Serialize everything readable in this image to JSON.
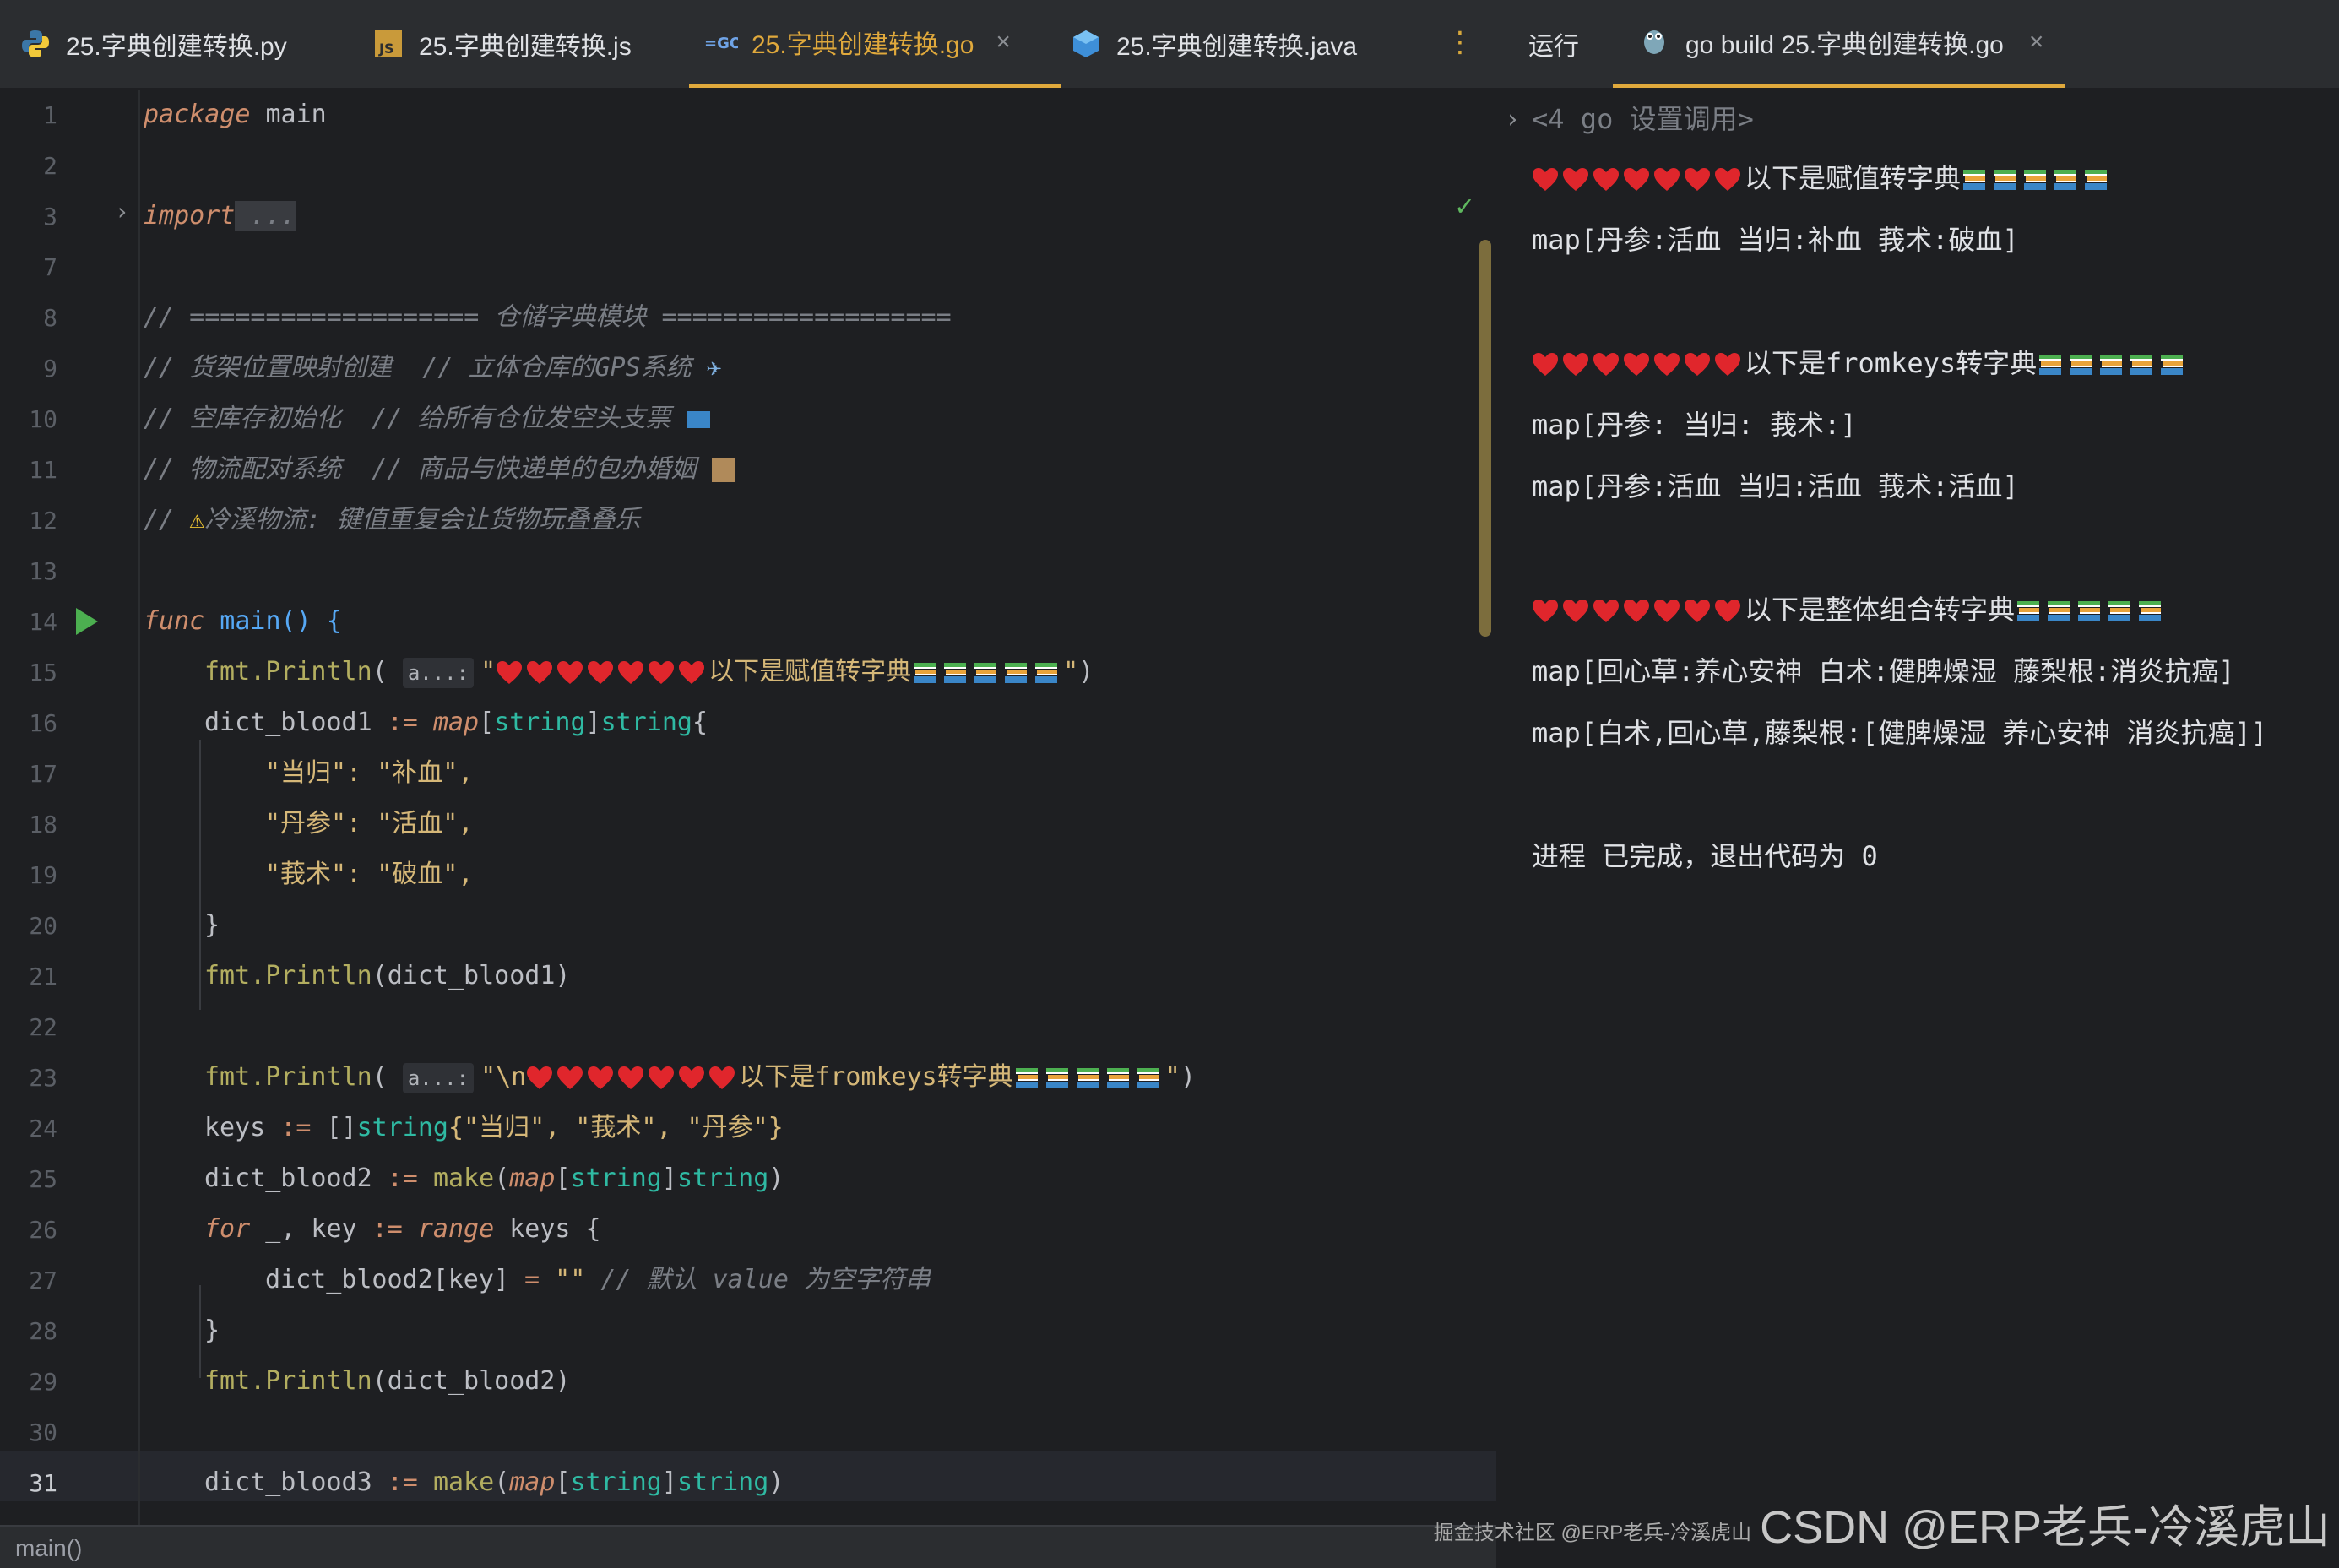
{
  "tabs": [
    {
      "label": "25.字典创建转换.py",
      "icon": "python-icon",
      "active": false
    },
    {
      "label": "25.字典创建转换.js",
      "icon": "js-icon",
      "active": false
    },
    {
      "label": "25.字典创建转换.go",
      "icon": "go-icon",
      "active": true
    },
    {
      "label": "25.字典创建转换.java",
      "icon": "java-icon",
      "active": false
    }
  ],
  "run_panel": {
    "label": "运行",
    "tab_title": "go build 25.字典创建转换.go",
    "close_glyph": "×",
    "header": "<4 go 设置调用>",
    "output": [
      "以下是赋值转字典",
      "map[丹参:活血 当归:补血 莪术:破血]",
      "",
      "以下是fromkeys转字典",
      "map[丹参: 当归: 莪术:]",
      "map[丹参:活血 当归:活血 莪术:活血]",
      "",
      "以下是整体组合转字典",
      "map[回心草:养心安神 白术:健脾燥湿 藤梨根:消炎抗癌]",
      "map[白术,回心草,藤梨根:[健脾燥湿 养心安神 消炎抗癌]]",
      "",
      "进程 已完成，退出代码为 0"
    ]
  },
  "editor": {
    "line_numbers": [
      "1",
      "2",
      "3",
      "7",
      "8",
      "9",
      "10",
      "11",
      "12",
      "13",
      "14",
      "15",
      "16",
      "17",
      "18",
      "19",
      "20",
      "21",
      "22",
      "23",
      "24",
      "25",
      "26",
      "27",
      "28",
      "29",
      "30",
      "31"
    ],
    "current_line": "31",
    "code": {
      "l1a": "package",
      "l1b": " main",
      "l3a": "import",
      "l3b": " ...",
      "l8": "// =================== 仓储字典模块 ===================",
      "l9": "// 货架位置映射创建  // 立体仓库的GPS系统",
      "l10": "// 空库存初始化  // 给所有仓位发空头支票",
      "l11": "// 物流配对系统  // 商品与快递单的包办婚姻",
      "l12a": "// ",
      "l12b": "冷溪物流: 键值重复会让货物玩叠叠乐",
      "l14a": "func",
      "l14b": " main() {",
      "hint": "a...:",
      "l15_fn": "Println",
      "l15_str_a": "\"",
      "l15_str_b": "以下是赋值转字典",
      "l15_str_c": "\"",
      "l16a": "dict_blood1",
      "l16b": " := ",
      "l16c": "map",
      "l16d": "[",
      "l16e": "string",
      "l16f": "]",
      "l16g": "string",
      "l16h": "{",
      "l17": "\"当归\": \"补血\",",
      "l18": "\"丹参\": \"活血\",",
      "l19": "\"莪术\": \"破血\",",
      "l20": "}",
      "l21b": "(dict_blood1)",
      "l23_str_a": "\"\\n",
      "l23_str_b": "以下是fromkeys转字典",
      "l23_str_c": "\"",
      "l24a": "keys",
      "l24b": " := ",
      "l24c": "[]",
      "l24d": "string",
      "l24e": "{\"当归\", \"莪术\", \"丹参\"}",
      "l25a": "dict_blood2",
      "l25c": "make",
      "l25d": "(",
      "l25e": "map",
      "l26a": "for",
      "l26b": " _, key ",
      "l26c": ":=",
      "l26d": " range",
      "l26e": " keys {",
      "l27a": "dict_blood2[key] ",
      "l27b": "=",
      "l27c": " \"\" ",
      "l27d": "// 默认 value 为空字符串",
      "l28": "}",
      "l29b": "(dict_blood2)",
      "l31a": "dict_blood3"
    },
    "breadcrumb": "main()"
  },
  "watermark": "CSDN @ERP老兵-冷溪虎山",
  "watermark_small": "掘金技术社区 @ERP老兵-冷溪虎山"
}
